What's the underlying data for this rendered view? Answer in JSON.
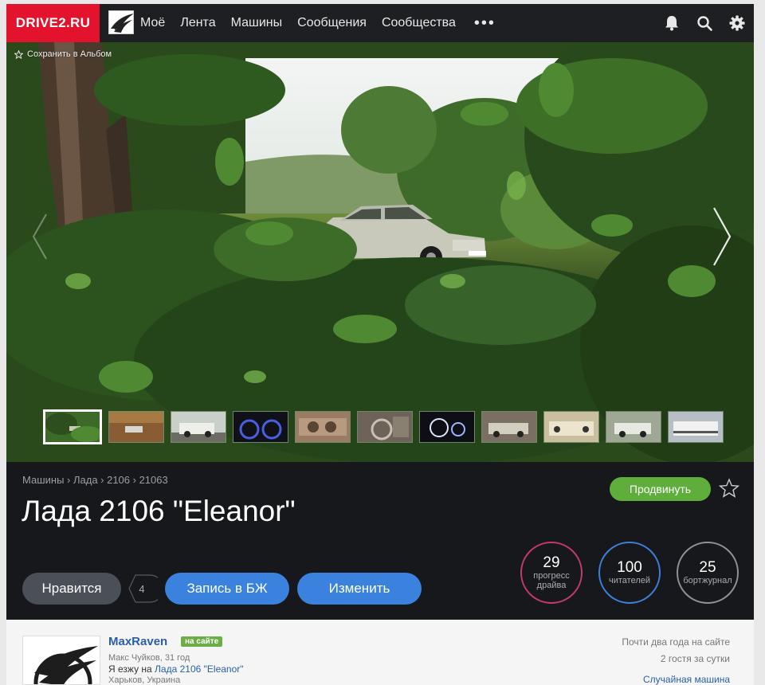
{
  "header": {
    "logo": "DRIVE2.RU",
    "nav": [
      "Моё",
      "Лента",
      "Машины",
      "Сообщения",
      "Сообщества"
    ],
    "more": "•••",
    "icons": [
      "bell-icon",
      "search-icon",
      "gear-icon"
    ]
  },
  "photo": {
    "save_label": "Сохранить в Альбом",
    "thumbnails_count": 11,
    "active_thumbnail": 1
  },
  "car": {
    "breadcrumb": "Машины › Лада › 2106 › 21063",
    "title": "Лада 2106 \"Eleanor\"",
    "promote_label": "Продвинуть",
    "like_label": "Нравится",
    "like_count": "4",
    "logbook_label": "Запись в БЖ",
    "edit_label": "Изменить",
    "stats": {
      "progress": {
        "value": "29",
        "label_1": "прогресс",
        "label_2": "драйва",
        "color": "#c23a6d"
      },
      "readers": {
        "value": "100",
        "label": "читателей",
        "color": "#3d80d8"
      },
      "journal": {
        "value": "25",
        "label": "бортжурнал",
        "color": "#8f9298"
      }
    }
  },
  "owner": {
    "name": "MaxRaven",
    "online_badge": "на сайте",
    "meta": "Макс Чуйков, 31 год",
    "drives_prefix": "Я езжу на ",
    "drives_car": "Лада 2106 \"Eleanor\"",
    "location": "Харьков, Украина",
    "side": [
      "Почти два года на сайте",
      "2 гостя за сутки",
      "Случайная машина"
    ]
  },
  "colors": {
    "brand": "#e3132d",
    "promote": "#5fae3c",
    "primary_button": "#3a82dd",
    "panel": "#17181c"
  }
}
